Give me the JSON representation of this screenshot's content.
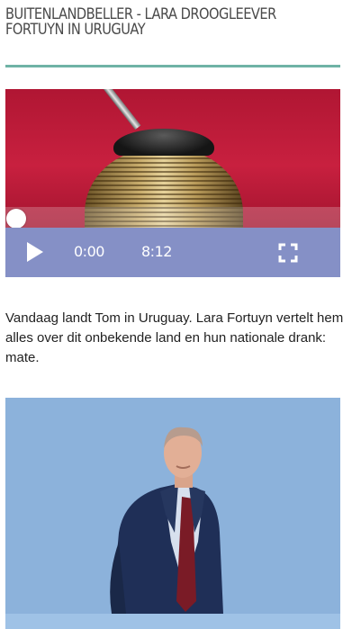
{
  "header": {
    "title": "Buitenlandbeller - Lara Droogleever Fortuyn in Uruguay"
  },
  "player": {
    "current_time": "0:00",
    "duration": "8:12",
    "progress": 0,
    "play_icon": "play-icon",
    "fullscreen_icon": "fullscreen-icon"
  },
  "article": {
    "text": "Vandaag landt Tom in Uruguay. Lara Fortuyn vertelt hem alles over dit onbekende land en hun nationale drank: mate."
  },
  "colors": {
    "accent_rule": "#6fb3a6",
    "player_controls": "#8590c6",
    "video_background": "#c21c3a",
    "photo_background": "#8cb2db"
  }
}
